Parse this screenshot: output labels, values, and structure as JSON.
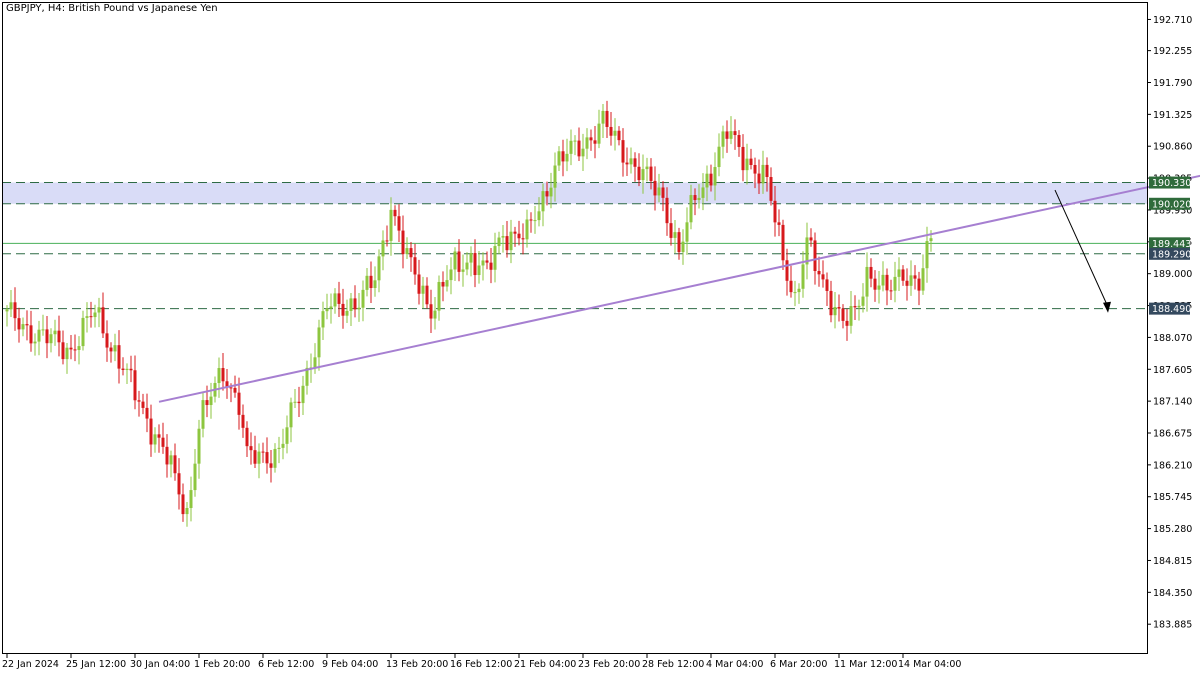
{
  "window": {
    "symbol": "GBPJPY",
    "timeframe": "H4",
    "description": "British Pound vs Japanese Yen",
    "title_text": "GBPJPY, H4:  British Pound vs Japanese Yen"
  },
  "colors": {
    "bull": "#8dc63f",
    "bear": "#d7191c",
    "trendline": "#a67fd1",
    "zone": "#d9dcf7",
    "dashed": "#2e6b45",
    "solid_level": "#49b15a",
    "tag_green": "#2f6b3b",
    "tag_dark": "#34495e"
  },
  "chart_data": {
    "type": "candlestick",
    "title": "GBPJPY, H4:  British Pound vs Japanese Yen",
    "ylim": [
      183.45,
      192.95
    ],
    "y_ticks": [
      "192.710",
      "192.255",
      "191.790",
      "191.325",
      "190.860",
      "190.395",
      "189.930",
      "189.465",
      "189.000",
      "188.535",
      "188.070",
      "187.605",
      "187.140",
      "186.675",
      "186.210",
      "185.745",
      "185.280",
      "184.815",
      "184.350",
      "183.885"
    ],
    "x_ticks": [
      "22 Jan 2024",
      "25 Jan 12:00",
      "30 Jan 04:00",
      "1 Feb 20:00",
      "6 Feb 12:00",
      "9 Feb 04:00",
      "13 Feb 20:00",
      "16 Feb 12:00",
      "21 Feb 04:00",
      "23 Feb 20:00",
      "28 Feb 12:00",
      "4 Mar 04:00",
      "6 Mar 20:00",
      "11 Mar 12:00",
      "14 Mar 04:00"
    ],
    "x_tick_index": [
      0,
      16,
      32,
      48,
      64,
      80,
      96,
      112,
      128,
      144,
      160,
      176,
      192,
      208,
      224
    ],
    "bar_count": 232,
    "anchors": [
      {
        "i": 0,
        "close": 188.4
      },
      {
        "i": 8,
        "close": 188.1
      },
      {
        "i": 16,
        "close": 187.9
      },
      {
        "i": 22,
        "close": 188.45
      },
      {
        "i": 32,
        "close": 187.25
      },
      {
        "i": 40,
        "close": 186.3
      },
      {
        "i": 45,
        "close": 185.5
      },
      {
        "i": 48,
        "close": 186.8
      },
      {
        "i": 54,
        "close": 187.6
      },
      {
        "i": 58,
        "close": 187.1
      },
      {
        "i": 60,
        "close": 186.3
      },
      {
        "i": 68,
        "close": 186.4
      },
      {
        "i": 74,
        "close": 187.4
      },
      {
        "i": 80,
        "close": 188.5
      },
      {
        "i": 88,
        "close": 188.6
      },
      {
        "i": 92,
        "close": 188.9
      },
      {
        "i": 96,
        "close": 190.0
      },
      {
        "i": 100,
        "close": 189.2
      },
      {
        "i": 106,
        "close": 188.5
      },
      {
        "i": 112,
        "close": 189.1
      },
      {
        "i": 116,
        "close": 189.25
      },
      {
        "i": 120,
        "close": 189.0
      },
      {
        "i": 124,
        "close": 189.6
      },
      {
        "i": 130,
        "close": 189.55
      },
      {
        "i": 134,
        "close": 190.1
      },
      {
        "i": 137,
        "close": 190.6
      },
      {
        "i": 144,
        "close": 190.9
      },
      {
        "i": 149,
        "close": 191.2
      },
      {
        "i": 152,
        "close": 190.95
      },
      {
        "i": 158,
        "close": 190.5
      },
      {
        "i": 164,
        "close": 190.1
      },
      {
        "i": 168,
        "close": 189.3
      },
      {
        "i": 172,
        "close": 190.1
      },
      {
        "i": 176,
        "close": 190.5
      },
      {
        "i": 180,
        "close": 191.05
      },
      {
        "i": 186,
        "close": 190.6
      },
      {
        "i": 190,
        "close": 190.3
      },
      {
        "i": 194,
        "close": 189.3
      },
      {
        "i": 197,
        "close": 188.6
      },
      {
        "i": 200,
        "close": 189.4
      },
      {
        "i": 204,
        "close": 188.9
      },
      {
        "i": 209,
        "close": 188.25
      },
      {
        "i": 212,
        "close": 188.4
      },
      {
        "i": 215,
        "close": 189.05
      },
      {
        "i": 220,
        "close": 188.7
      },
      {
        "i": 224,
        "close": 189.05
      },
      {
        "i": 228,
        "close": 188.85
      },
      {
        "i": 231,
        "close": 189.45
      }
    ],
    "levels": [
      {
        "price": 190.33,
        "label": "190.330",
        "style": "dashed",
        "tag": "green"
      },
      {
        "price": 190.02,
        "label": "190.020",
        "style": "dashed",
        "tag": "green"
      },
      {
        "price": 189.443,
        "label": "189.443",
        "style": "solid",
        "tag": "green"
      },
      {
        "price": 189.29,
        "label": "189.290",
        "style": "dashed",
        "tag": "dark"
      },
      {
        "price": 188.49,
        "label": "188.490",
        "style": "dashed",
        "tag": "dark"
      }
    ],
    "zone": {
      "from": 190.02,
      "to": 190.33
    },
    "trendline": {
      "start": {
        "i": 38,
        "price": 187.13
      },
      "end": {
        "i": 315,
        "price": 190.64
      }
    },
    "projection_arrow": {
      "start": {
        "i": 262,
        "price": 190.22
      },
      "end": {
        "i": 275,
        "price": 188.43
      }
    }
  }
}
